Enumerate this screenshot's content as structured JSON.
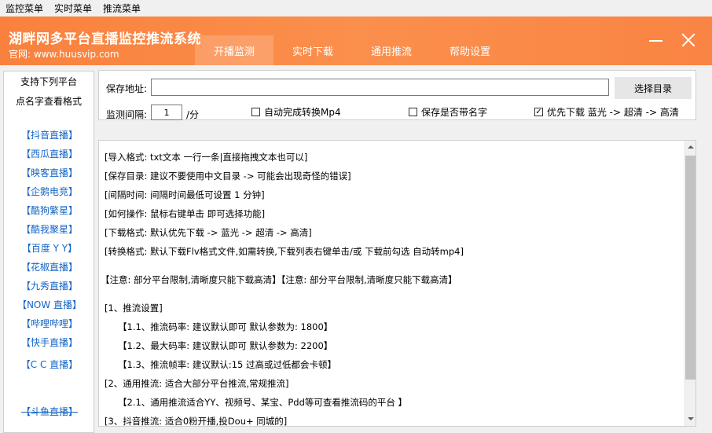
{
  "menu": [
    "监控菜单",
    "实时菜单",
    "推流菜单"
  ],
  "header": {
    "title": "湖畔网多平台直播监控推流系统",
    "site": "官网: www.huusvip.com",
    "tabs": [
      "开播监测",
      "实时下载",
      "通用推流",
      "帮助设置"
    ],
    "active_tab": 0
  },
  "sidebar": {
    "heading1": "支持下列平台",
    "heading2": "点名字查看格式",
    "platforms": [
      "【抖音直播】",
      "【西瓜直播】",
      "【映客直播】",
      "【企鹅电竞】",
      "【酷狗繁星】",
      "【酷我聚星】",
      "【百度 Y Y】",
      "【花椒直播】",
      "【九秀直播】",
      "【NOW 直播】",
      "【哔哩哔哩】",
      "【快手直播】",
      "【C C 直播】",
      "【斗鱼直播】"
    ]
  },
  "settings": {
    "path_label": "保存地址:",
    "path_value": "",
    "browse_label": "选择目录",
    "interval_label": "监测间隔:",
    "interval_value": "1",
    "interval_unit": "/分",
    "checkboxes": [
      {
        "label": "自动完成转换Mp4",
        "checked": false,
        "mark": ""
      },
      {
        "label": "保存是否带名字",
        "checked": false,
        "mark": ""
      },
      {
        "label": "优先下载 蓝光 -> 超清 -> 高清",
        "checked": true,
        "mark": "✓"
      }
    ]
  },
  "log": [
    "[导入格式: txt文本 一行一条|直接拖拽文本也可以]",
    "[保存目录: 建议不要使用中文目录 -> 可能会出现奇怪的错误]",
    "[间隔时间: 间隔时间最低可设置 1 分钟]",
    "[如何操作: 鼠标右键单击 即可选择功能]",
    "[下载格式: 默认优先下载 -> 蓝光 -> 超清 -> 高清]",
    "[转换格式: 默认下载Flv格式文件,如需转换,下载列表右键单击/或 下载前勾选 自动转mp4]",
    "【注意: 部分平台限制,清晰度只能下载高清】【注意: 部分平台限制,清晰度只能下载高清】",
    "[1、推流设置]",
    "【1.1、推流码率: 建议默认即可 默认参数为: 1800】",
    "【1.2、最大码率: 建议默认即可 默认参数为: 2200】",
    "【1.3、推流帧率: 建议默认:15 过高或过低都会卡顿】",
    "[2、通用推流: 适合大部分平台推流,常规推流]",
    "【2.1、通用推流适合YY、视频号、某宝、Pdd等可查看推流码的平台 】",
    "[3、抖音推流: 适合0粉开播,投Dou+ 同城的]"
  ],
  "colors": {
    "header_bg": "#fa8443",
    "platform_link": "#1565c6"
  }
}
